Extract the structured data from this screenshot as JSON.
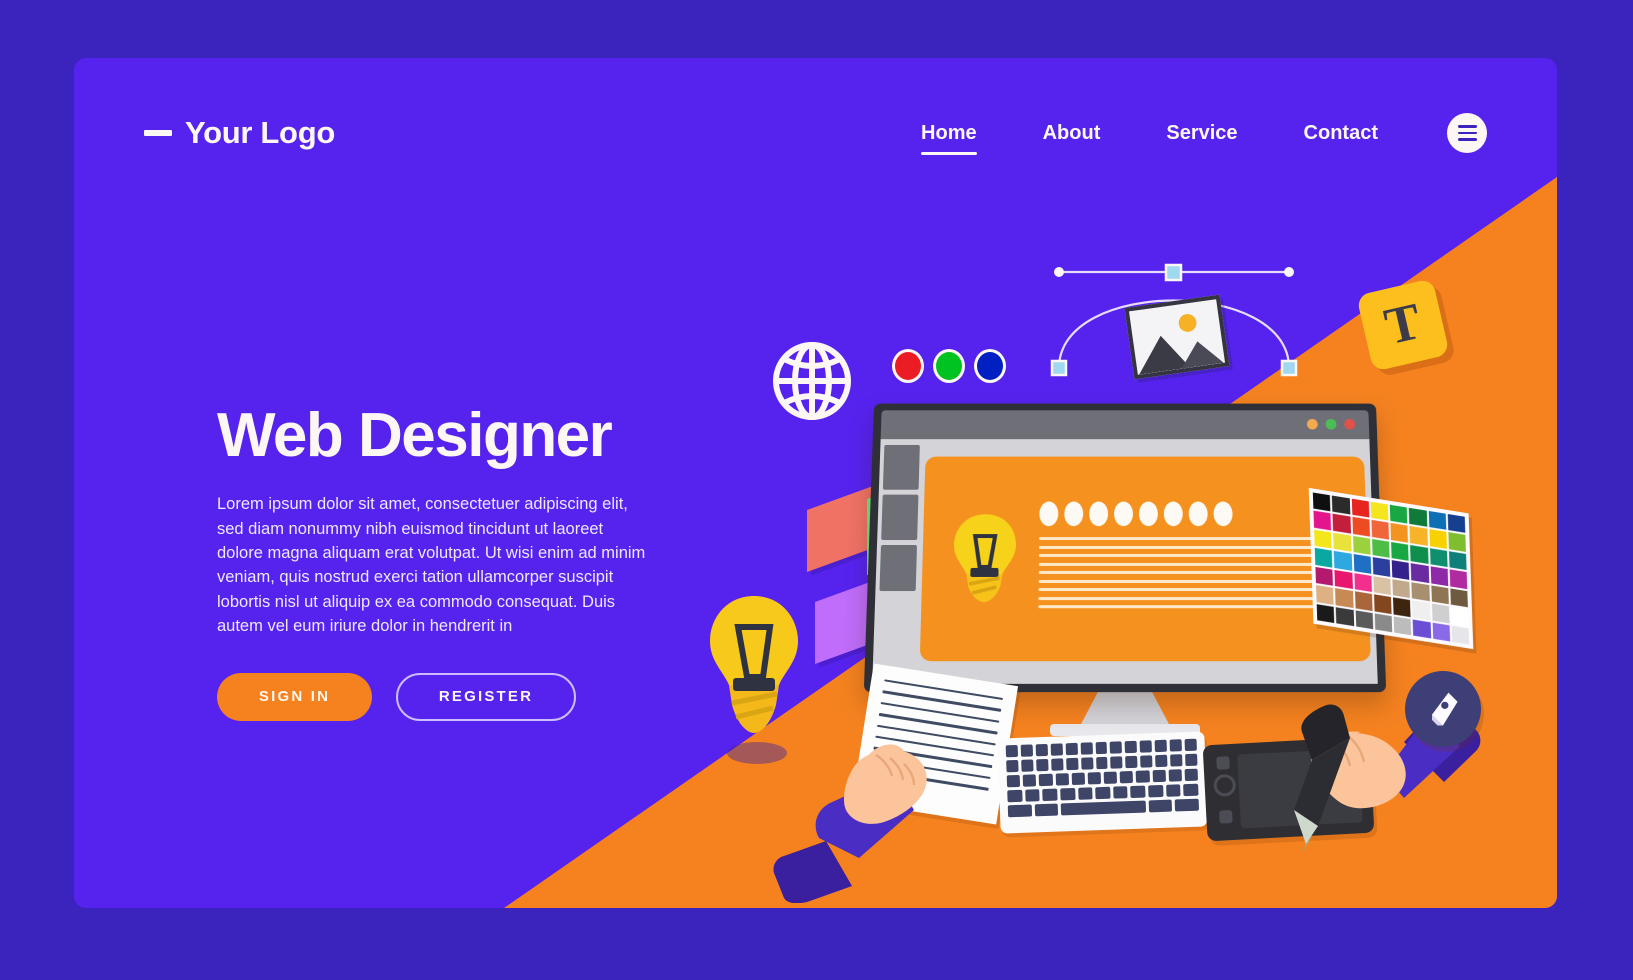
{
  "theme": {
    "outer_bg": "#3a24bd",
    "card_bg": "#5522ee",
    "accent_orange": "#f5821f",
    "text_light": "#fdf7f4",
    "body_text": "#efe8ff",
    "yellow": "#fcbf1e"
  },
  "header": {
    "logo_text": "Your Logo",
    "logo_mark": "dash-icon",
    "menu_icon": "hamburger-menu-icon",
    "nav": [
      {
        "label": "Home",
        "active": true
      },
      {
        "label": "About",
        "active": false
      },
      {
        "label": "Service",
        "active": false
      },
      {
        "label": "Contact",
        "active": false
      }
    ]
  },
  "hero": {
    "headline": "Web Designer",
    "paragraph": "Lorem ipsum dolor sit amet, consectetuer adipiscing elit, sed diam nonummy nibh euismod tincidunt ut laoreet dolore magna aliquam erat volutpat. Ut wisi enim ad minim veniam, quis nostrud exerci tation ullamcorper suscipit lobortis nisl ut aliquip ex ea commodo consequat. Duis autem vel eum iriure dolor in hendrerit in",
    "primary_cta": "SIGN IN",
    "secondary_cta": "REGISTER"
  },
  "illustration": {
    "globe_icon": "globe-icon",
    "rgb_dots": [
      {
        "name": "red-color-dot",
        "color": "#ec1c24"
      },
      {
        "name": "green-color-dot",
        "color": "#00c221"
      },
      {
        "name": "blue-color-dot",
        "color": "#0020c2"
      }
    ],
    "bezier_icon": "bezier-curve-icon",
    "photo_icon": "image-thumbnail-icon",
    "text_tool_badge": "T",
    "pen_tool_icon": "pen-tool-icon",
    "monitor": {
      "window_dots": [
        "#f3a94f",
        "#4bbf55",
        "#e0514b"
      ],
      "canvas_bg": "#f5911e",
      "canvas_icon": "lightbulb-icon",
      "canvas_oval_count": 8,
      "canvas_line_count": 9,
      "rail_block_count": 4
    },
    "sticky_notes": [
      {
        "name": "sticky-note-red",
        "color": "#ef7265"
      },
      {
        "name": "sticky-note-green",
        "color": "#6de87a"
      },
      {
        "name": "sticky-note-yellow",
        "color": "#f7d618"
      },
      {
        "name": "sticky-note-violet",
        "color": "#c06dfb"
      }
    ],
    "big_bulb_icon": "lightbulb-icon",
    "palette_swatches": [
      "#0f0f0f",
      "#2b2b2b",
      "#e8241f",
      "#f5e51c",
      "#17a844",
      "#0f7a3a",
      "#0e6fb5",
      "#163f8f",
      "#e3158d",
      "#c41f3a",
      "#ee4b22",
      "#f0663a",
      "#f39421",
      "#f7b429",
      "#f7d200",
      "#7fbf2f",
      "#f3e71c",
      "#e8e23a",
      "#9bd13c",
      "#4dbd45",
      "#17a844",
      "#0f8f4e",
      "#0e8f6e",
      "#0e7f7a",
      "#09a8a0",
      "#2da8e0",
      "#1f6fc4",
      "#2a3f9e",
      "#34218c",
      "#6a2aa0",
      "#8e2aa8",
      "#b02aa0",
      "#b31a6e",
      "#e8166e",
      "#f22f8c",
      "#d9c2a4",
      "#c2a98c",
      "#a88f6f",
      "#8f7553",
      "#6e5a3e",
      "#ddb184",
      "#c78a55",
      "#a8663a",
      "#83471f",
      "#3d2510",
      "#efefef",
      "#cfcfcf",
      "#ffffff",
      "#1a1a1a",
      "#3a3a3a",
      "#5a5a5a",
      "#8a8a8a",
      "#bcbcbc",
      "#6a4fd6",
      "#8a6ae8",
      "#e6e6ea"
    ],
    "paper_icon": "lined-paper-icon",
    "keyboard_icon": "keyboard-icon",
    "tablet_icon": "graphics-tablet-icon",
    "stylus_icon": "stylus-pen-icon",
    "left_hand": "left-hand-icon",
    "right_hand": "right-hand-icon"
  }
}
